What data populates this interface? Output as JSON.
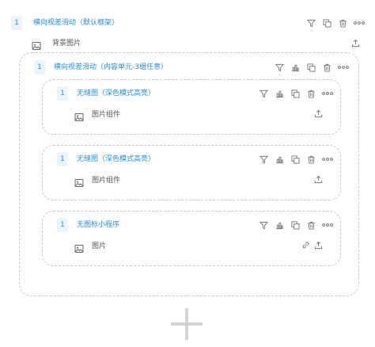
{
  "top": {
    "number": "1",
    "title": "横向视差滑动（默认框架）",
    "background_label": "背景图片"
  },
  "group": {
    "number": "1",
    "title": "横向视差滑动（内容单元-3组任意）"
  },
  "cards": [
    {
      "number": "1",
      "title": "无缝图（深色模式高亮）",
      "component_label": "图片组件"
    },
    {
      "number": "1",
      "title": "无缝图（深色模式高亮）",
      "component_label": "图片组件"
    },
    {
      "number": "1",
      "title": "无图标小程序",
      "component_label": "图片"
    }
  ],
  "colors": {
    "accent": "#2a8fe0",
    "badge_bg": "#eaf4fd",
    "icon_gray": "#777777",
    "dashed_border": "#c9c9c9"
  },
  "icons": {
    "filter": "filter-icon",
    "chart": "bar-chart-icon",
    "copy": "copy-icon",
    "delete": "trash-icon",
    "more": "more-icon",
    "upload": "upload-icon",
    "image": "image-icon",
    "link": "link-icon",
    "add": "plus-icon"
  }
}
